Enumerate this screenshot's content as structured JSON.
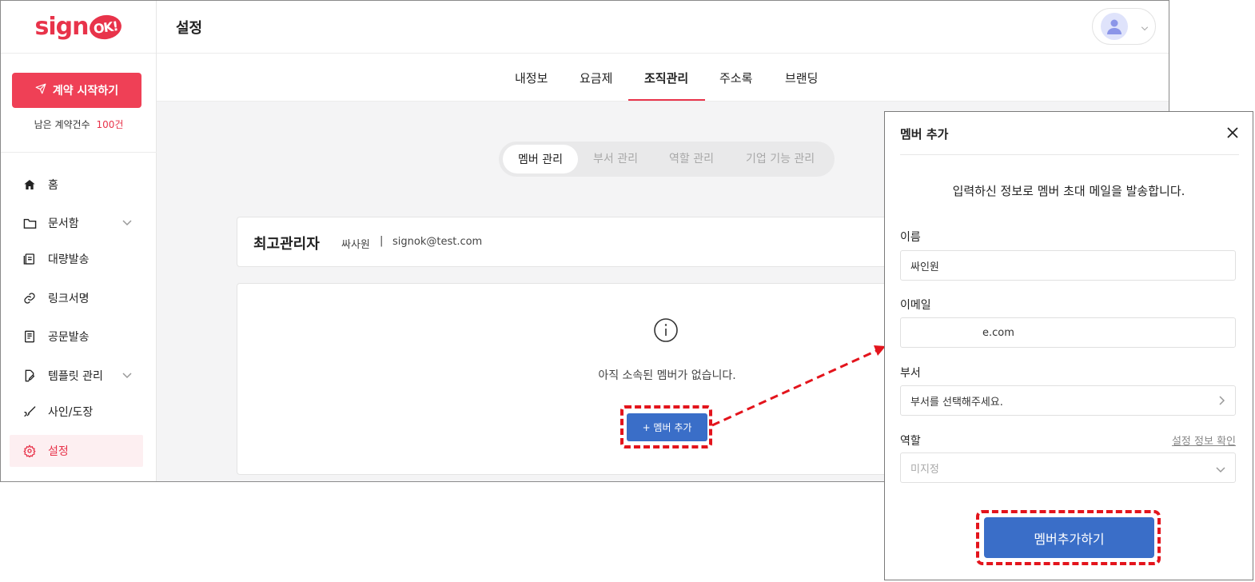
{
  "brand": {
    "logo_text": "sign",
    "logo_mark": "OK!",
    "accent": "#e8334a",
    "primary": "#3a6ec8"
  },
  "sidebar": {
    "start_button": "계약 시작하기",
    "remaining_label": "남은 계약건수",
    "remaining_count": "100건",
    "items": [
      {
        "label": "홈",
        "icon": "home-icon"
      },
      {
        "label": "문서함",
        "icon": "folder-icon"
      },
      {
        "label": "대량발송",
        "icon": "bulk-send-icon"
      },
      {
        "label": "링크서명",
        "icon": "link-icon"
      },
      {
        "label": "공문발송",
        "icon": "document-icon"
      },
      {
        "label": "템플릿 관리",
        "icon": "template-icon"
      },
      {
        "label": "사인/도장",
        "icon": "signature-icon"
      },
      {
        "label": "설정",
        "icon": "gear-icon"
      }
    ]
  },
  "header": {
    "title": "설정"
  },
  "tabs": [
    "내정보",
    "요금제",
    "조직관리",
    "주소록",
    "브랜딩"
  ],
  "subtabs": [
    "멤버 관리",
    "부서 관리",
    "역할 관리",
    "기업 기능 관리"
  ],
  "admin": {
    "title": "최고관리자",
    "name": "싸사원",
    "separator": "|",
    "email": "signok@test.com"
  },
  "empty": {
    "message": "아직 소속된 멤버가 없습니다.",
    "button": "+ 멤버 추가"
  },
  "modal": {
    "title": "멤버 추가",
    "description": "입력하신 정보로 멤버 초대 메일을 발송합니다.",
    "name_label": "이름",
    "name_value": "싸인원",
    "email_label": "이메일",
    "email_value": "e.com",
    "dept_label": "부서",
    "dept_value": "부서를 선택해주세요.",
    "role_label": "역할",
    "role_link": "설정 정보 확인",
    "role_value": "미지정",
    "submit": "멤버추가하기"
  }
}
